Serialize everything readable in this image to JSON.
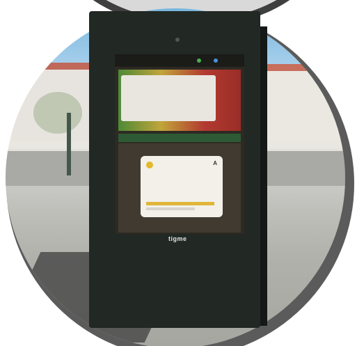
{
  "kiosk": {
    "status_time": "",
    "banner_text": "",
    "notice_badge": "A",
    "notice_title": "",
    "brand": "tigme"
  }
}
